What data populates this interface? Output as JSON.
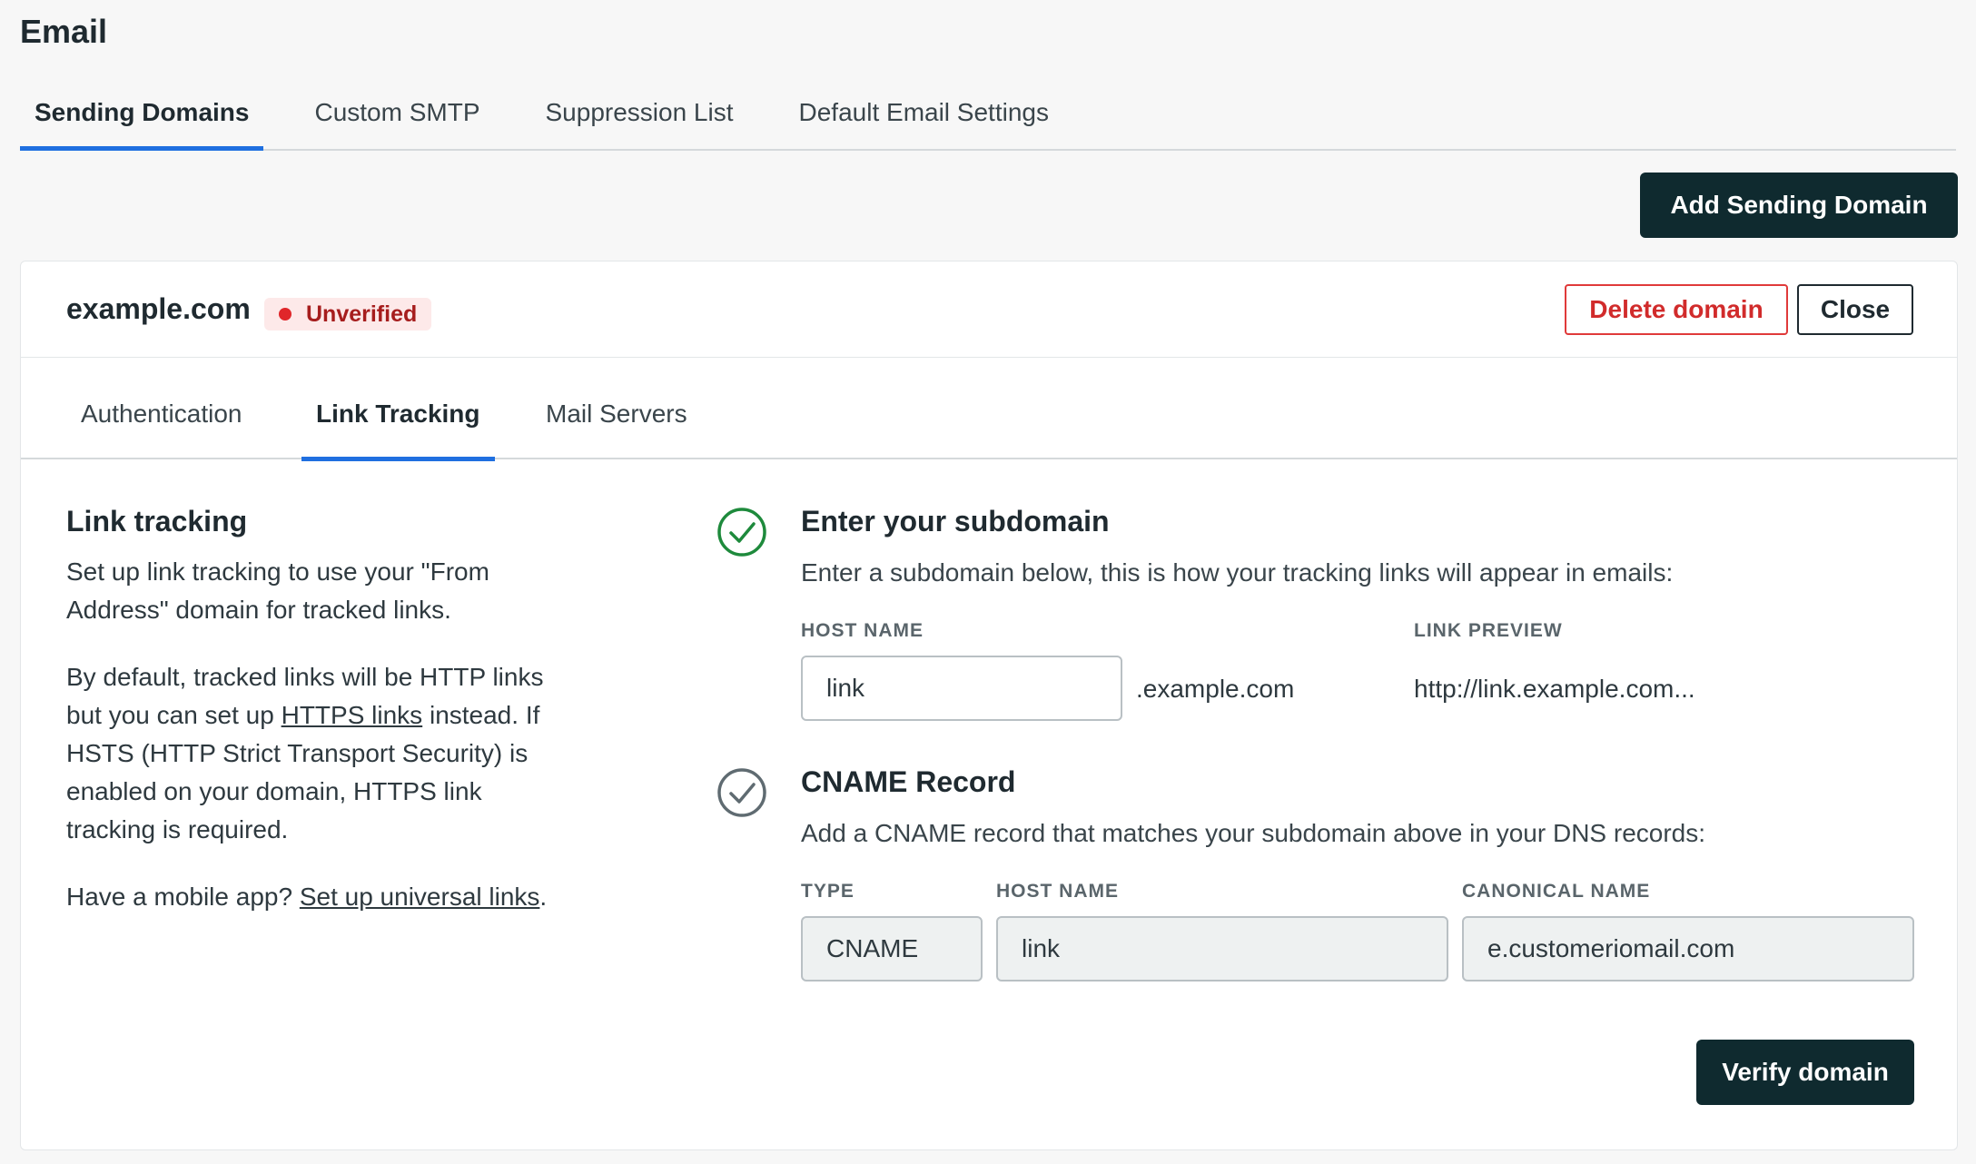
{
  "page": {
    "title": "Email"
  },
  "top_tabs": [
    {
      "label": "Sending Domains",
      "active": true
    },
    {
      "label": "Custom SMTP",
      "active": false
    },
    {
      "label": "Suppression List",
      "active": false
    },
    {
      "label": "Default Email Settings",
      "active": false
    }
  ],
  "actions": {
    "add_domain": "Add Sending Domain"
  },
  "domain": {
    "name": "example.com",
    "status": "Unverified",
    "delete_label": "Delete domain",
    "close_label": "Close"
  },
  "sub_tabs": [
    {
      "label": "Authentication",
      "active": false
    },
    {
      "label": "Link Tracking",
      "active": true
    },
    {
      "label": "Mail Servers",
      "active": false
    }
  ],
  "info": {
    "title": "Link tracking",
    "p1": "Set up link tracking to use your \"From Address\" domain for tracked links.",
    "p2_a": "By default, tracked links will be HTTP links but you can set up ",
    "p2_link": "HTTPS links",
    "p2_b": " instead. If HSTS (HTTP Strict Transport Security) is enabled on your domain, HTTPS link tracking is required.",
    "p3_a": "Have a mobile app? ",
    "p3_link": "Set up universal links",
    "p3_b": "."
  },
  "step1": {
    "title": "Enter your subdomain",
    "description": "Enter a subdomain below, this is how your tracking links will appear in emails:",
    "host_label": "HOST NAME",
    "host_value": "link",
    "suffix": ".example.com",
    "preview_label": "LINK PREVIEW",
    "preview_value": "http://link.example.com..."
  },
  "step2": {
    "title": "CNAME Record",
    "description": "Add a CNAME record that matches your subdomain above in your DNS records:",
    "type_label": "TYPE",
    "type_value": "CNAME",
    "host_label": "HOST NAME",
    "host_value": "link",
    "canonical_label": "CANONICAL NAME",
    "canonical_value": "e.customeriomail.com"
  },
  "verify_label": "Verify domain",
  "colors": {
    "accent": "#1f6fe0",
    "primary_button": "#0f2a2f",
    "danger": "#d12b2b",
    "success": "#1e8a3c",
    "muted_check": "#5f6b71"
  },
  "icons": {
    "step1": "check-circle-icon",
    "step2": "check-circle-icon"
  }
}
